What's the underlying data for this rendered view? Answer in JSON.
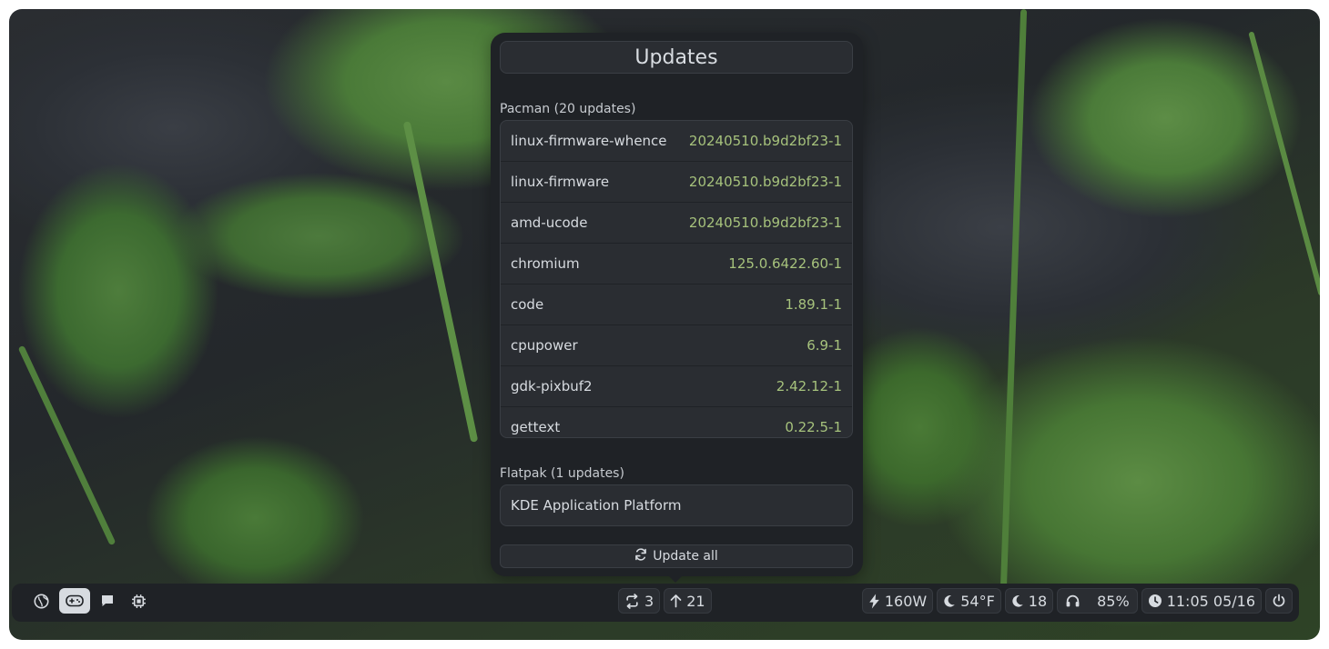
{
  "popup": {
    "title": "Updates",
    "pacman_label": "Pacman (20 updates)",
    "pacman_updates": [
      {
        "name": "linux-firmware-whence",
        "version": "20240510.b9d2bf23-1"
      },
      {
        "name": "linux-firmware",
        "version": "20240510.b9d2bf23-1"
      },
      {
        "name": "amd-ucode",
        "version": "20240510.b9d2bf23-1"
      },
      {
        "name": "chromium",
        "version": "125.0.6422.60-1"
      },
      {
        "name": "code",
        "version": "1.89.1-1"
      },
      {
        "name": "cpupower",
        "version": "6.9-1"
      },
      {
        "name": "gdk-pixbuf2",
        "version": "2.42.12-1"
      },
      {
        "name": "gettext",
        "version": "0.22.5-1"
      }
    ],
    "flatpak_label": "Flatpak (1 updates)",
    "flatpak_updates": [
      {
        "name": "KDE Application Platform"
      }
    ],
    "update_all_label": "Update all",
    "update_all_icon": "refresh-icon"
  },
  "bar": {
    "left_icons": [
      "globe-icon",
      "gamepad-icon",
      "chat-icon",
      "cpu-icon"
    ],
    "active_left_icon": "gamepad-icon",
    "sync_count": "3",
    "updates_count": "21",
    "power": "160W",
    "weather": "54°F",
    "moon_value": "18",
    "headset_battery": "85%",
    "clock": "11:05 05/16"
  }
}
